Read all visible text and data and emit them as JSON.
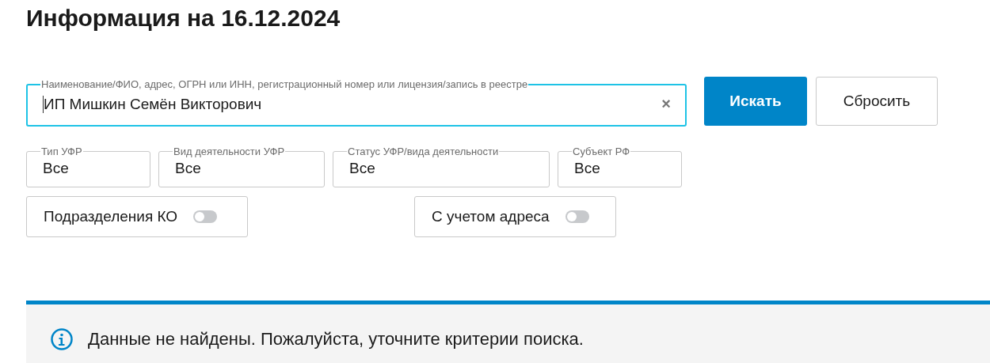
{
  "title": "Информация на 16.12.2024",
  "search": {
    "label": "Наименование/ФИО, адрес, ОГРН или ИНН, регистрационный номер или лицензия/запись в реестре",
    "value": "ИП Мишкин Семён Викторович",
    "clear": "×"
  },
  "buttons": [
    {
      "label": "Искать",
      "kind": "primary"
    },
    {
      "label": "Сбросить",
      "kind": "secondary"
    }
  ],
  "filters": [
    {
      "kind": "select",
      "label": "Тип УФР",
      "value": "Все"
    },
    {
      "kind": "select",
      "label": "Вид деятельности УФР",
      "value": "Все"
    },
    {
      "kind": "select",
      "label": "Статус УФР/вида деятельности",
      "value": "Все"
    },
    {
      "kind": "select",
      "label": "Субъект РФ",
      "value": "Все"
    },
    {
      "kind": "toggle",
      "label": "Подразделения КО",
      "on": false
    },
    {
      "kind": "toggle",
      "label": "С учетом адреса",
      "on": false
    }
  ],
  "message": {
    "text": "Данные не найдены. Пожалуйста, уточните критерии поиска."
  }
}
